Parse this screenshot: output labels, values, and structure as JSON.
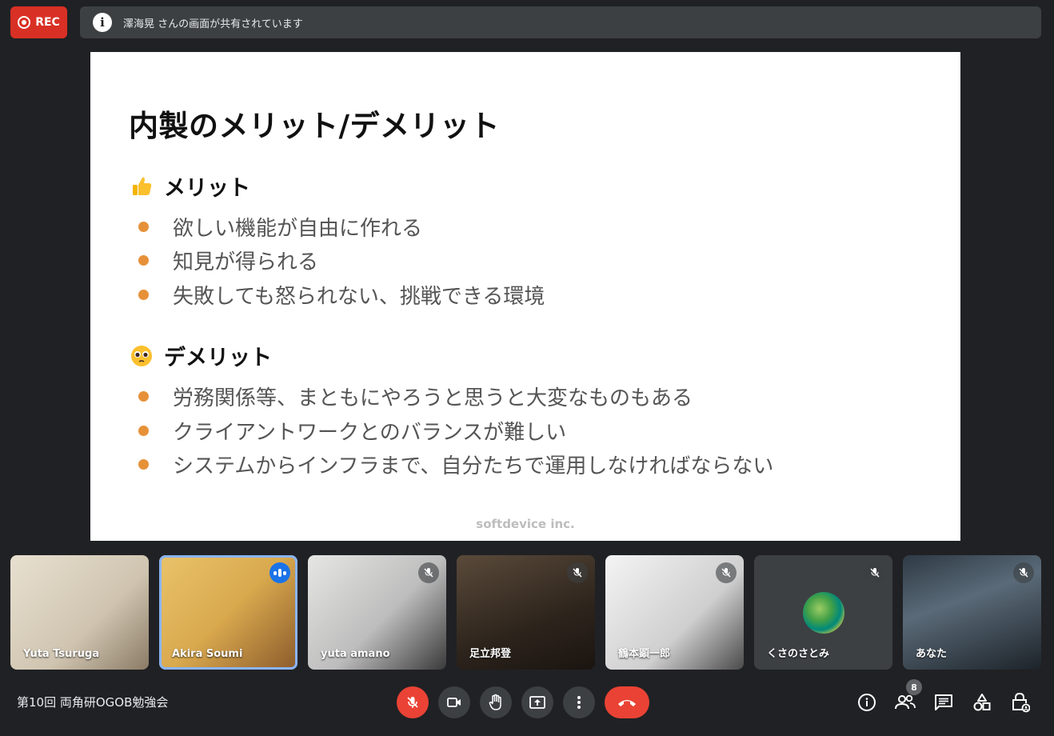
{
  "rec": {
    "label": "REC"
  },
  "banner": {
    "text": "澤海晃 さんの画面が共有されています",
    "info_icon": "i"
  },
  "slide": {
    "title": "内製のメリット/デメリット",
    "sections": [
      {
        "heading": "メリット",
        "icon": "thumbs-up-emoji",
        "items": [
          "欲しい機能が自由に作れる",
          "知見が得られる",
          "失敗しても怒られない、挑戦できる環境"
        ]
      },
      {
        "heading": "デメリット",
        "icon": "pleading-face-emoji",
        "items": [
          "労務関係等、まともにやろうと思うと大変なものもある",
          "クライアントワークとのバランスが難しい",
          "システムからインフラまで、自分たちで運用しなければならない"
        ]
      }
    ],
    "footer": "softdevice inc.",
    "bullet_color": "#e69138"
  },
  "participants": [
    {
      "name": "Yuta Tsuruga",
      "muted": false,
      "speaking": false
    },
    {
      "name": "Akira Soumi",
      "muted": false,
      "speaking": true
    },
    {
      "name": "yuta amano",
      "muted": true,
      "speaking": false
    },
    {
      "name": "足立邦登",
      "muted": true,
      "speaking": false
    },
    {
      "name": "鶴本顕一郎",
      "muted": true,
      "speaking": false
    },
    {
      "name": "くさのさとみ",
      "muted": true,
      "speaking": false
    },
    {
      "name": "あなた",
      "muted": true,
      "speaking": false
    }
  ],
  "bottom": {
    "meeting_title": "第10回 両角研OGOB勉強会",
    "participant_count": "8"
  },
  "colors": {
    "end_call": "#ea4335",
    "accent": "#1a73e8",
    "rec": "#d93025"
  }
}
